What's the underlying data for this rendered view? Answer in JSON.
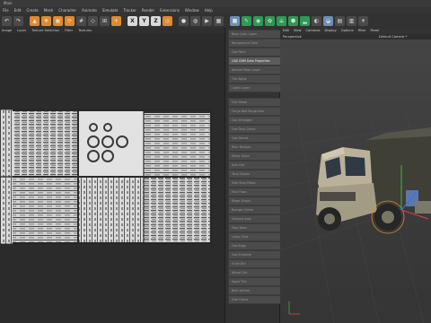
{
  "app": {
    "title": "Main"
  },
  "menu": [
    "File",
    "Edit",
    "Create",
    "Mesh",
    "Character",
    "Animate",
    "Simulate",
    "Tracker",
    "Render",
    "Extensions",
    "Window",
    "Help"
  ],
  "toolbar": {
    "x_label": "X",
    "y_label": "Y",
    "z_label": "Z"
  },
  "uv_editor": {
    "menu": [
      "Image",
      "Layer",
      "Texture Selection",
      "Filter",
      "Textures"
    ]
  },
  "layers_panel": {
    "items": [
      "Base Color Layer",
      "Background Color",
      "Cab Paint",
      "CAB CMM Data Properties",
      "Normal Maps Layer",
      "Tire Alpha",
      "Lights Layer",
      "Cab Detail",
      "Cargo Bed Roughness",
      "Cab Smudges",
      "Fuel Tank Grime",
      "Cab Decals",
      "Rear Bumper",
      "Mirror Glass",
      "Axle Dirt",
      "Tank Stripes",
      "Side Step Plates",
      "Mud Flaps",
      "Ridge Straps",
      "Bumper Grime",
      "Exhaust Soot",
      "Step Wear",
      "Lamp Glow",
      "Cab Edge",
      "Cab Emissive",
      "Grille Dirt",
      "Wheel Dirt",
      "Spare Tire",
      "Bed Latches",
      "Side Frame"
    ],
    "selected_index": 3
  },
  "viewport": {
    "menu": [
      "Edit",
      "View",
      "Cameras",
      "Display",
      "Options",
      "Filter",
      "Panel"
    ],
    "view_name": "Perspective",
    "camera": "Default Camera *"
  },
  "colors": {
    "accent": "#e08a2c",
    "selection": "#5b5b5b"
  }
}
